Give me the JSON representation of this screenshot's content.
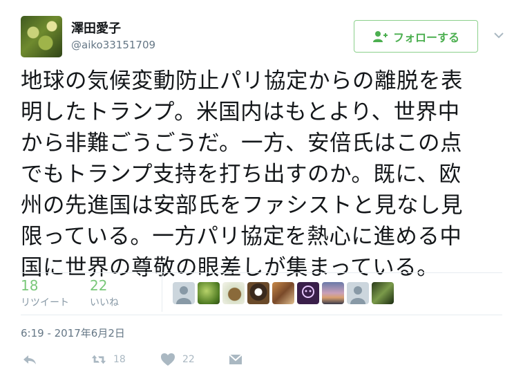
{
  "user": {
    "name": "澤田愛子",
    "handle": "@aiko33151709"
  },
  "follow_button": {
    "label": "フォローする",
    "icon": "follow-user-icon"
  },
  "tweet": {
    "text": "地球の気候変動防止パリ協定からの離脱を表\n明したトランプ。米国内はもとより、世界中\nから非難ごうごうだ。一方、安倍氏はこの点\nでもトランプ支持を打ち出すのか。既に、欧\n州の先進国は安部氏をファシストと見なし見\n限っている。一方パリ協定を熱心に進める中\n国に世界の尊敬の眼差しが集まっている。",
    "timestamp": "6:19 - 2017年6月2日"
  },
  "stats": {
    "retweets": {
      "count": "18",
      "label": "リツイート"
    },
    "likes": {
      "count": "22",
      "label": "いいね"
    }
  },
  "liker_avatars": [
    "default-avatar",
    "plant-avatar",
    "animal-avatar",
    "dog-avatar",
    "photo-avatar",
    "drawing-avatar",
    "sunset-avatar",
    "default-avatar",
    "plant-avatar"
  ],
  "actions": {
    "retweet_count": "18",
    "like_count": "22"
  },
  "colors": {
    "accent_green": "#79c779",
    "follow_border": "#8bd08b",
    "muted": "#657786",
    "icon_gray": "#aab8c2"
  }
}
